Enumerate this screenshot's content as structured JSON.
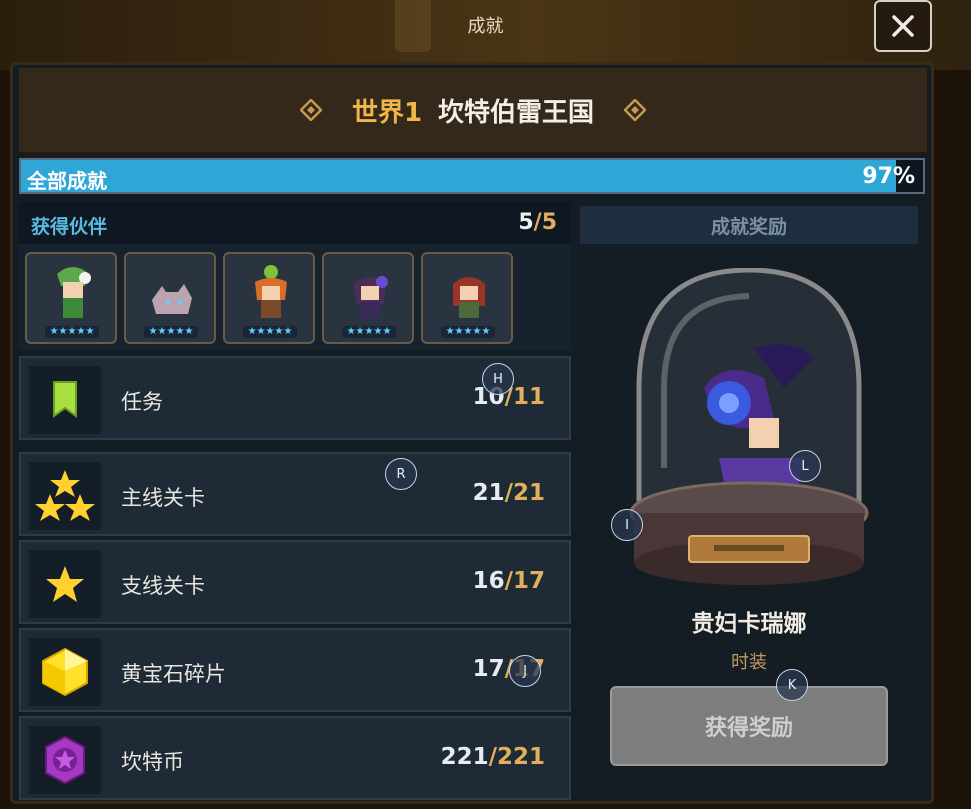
{
  "window": {
    "title": "成就"
  },
  "header": {
    "world": "世界1",
    "kingdom": "坎特伯雷王国"
  },
  "progress": {
    "label": "全部成就",
    "percent_text": "97%",
    "percent": 97
  },
  "partners": {
    "title": "获得伙伴",
    "current": "5",
    "max": "/5",
    "items": [
      {
        "icon": "plant-girl-portrait",
        "stars": "★★★★★"
      },
      {
        "icon": "wolf-portrait",
        "stars": "★★★★★"
      },
      {
        "icon": "apple-girl-portrait",
        "stars": "★★★★★"
      },
      {
        "icon": "purple-girl-portrait",
        "stars": "★★★★★"
      },
      {
        "icon": "red-hair-girl-portrait",
        "stars": "★★★★★"
      }
    ]
  },
  "rows": [
    {
      "name": "任务",
      "current": "10",
      "max": "/11",
      "icon": "bookmark-icon"
    },
    {
      "name": "主线关卡",
      "current": "21",
      "max": "/21",
      "icon": "three-stars-icon"
    },
    {
      "name": "支线关卡",
      "current": "16",
      "max": "/17",
      "icon": "star-icon"
    },
    {
      "name": "黄宝石碎片",
      "current": "17",
      "max": "/17",
      "icon": "gem-icon"
    },
    {
      "name": "坎特币",
      "current": "221",
      "max": "/221",
      "icon": "coin-icon"
    }
  ],
  "reward": {
    "header": "成就奖励",
    "name": "贵妇卡瑞娜",
    "type": "时装",
    "button": "获得奖励"
  },
  "markers": [
    "H",
    "R",
    "I",
    "L",
    "J",
    "K"
  ],
  "colors": {
    "accent_gold": "#e2b05a",
    "progress_blue": "#2ea6d6",
    "partner_title": "#59b9e0"
  }
}
